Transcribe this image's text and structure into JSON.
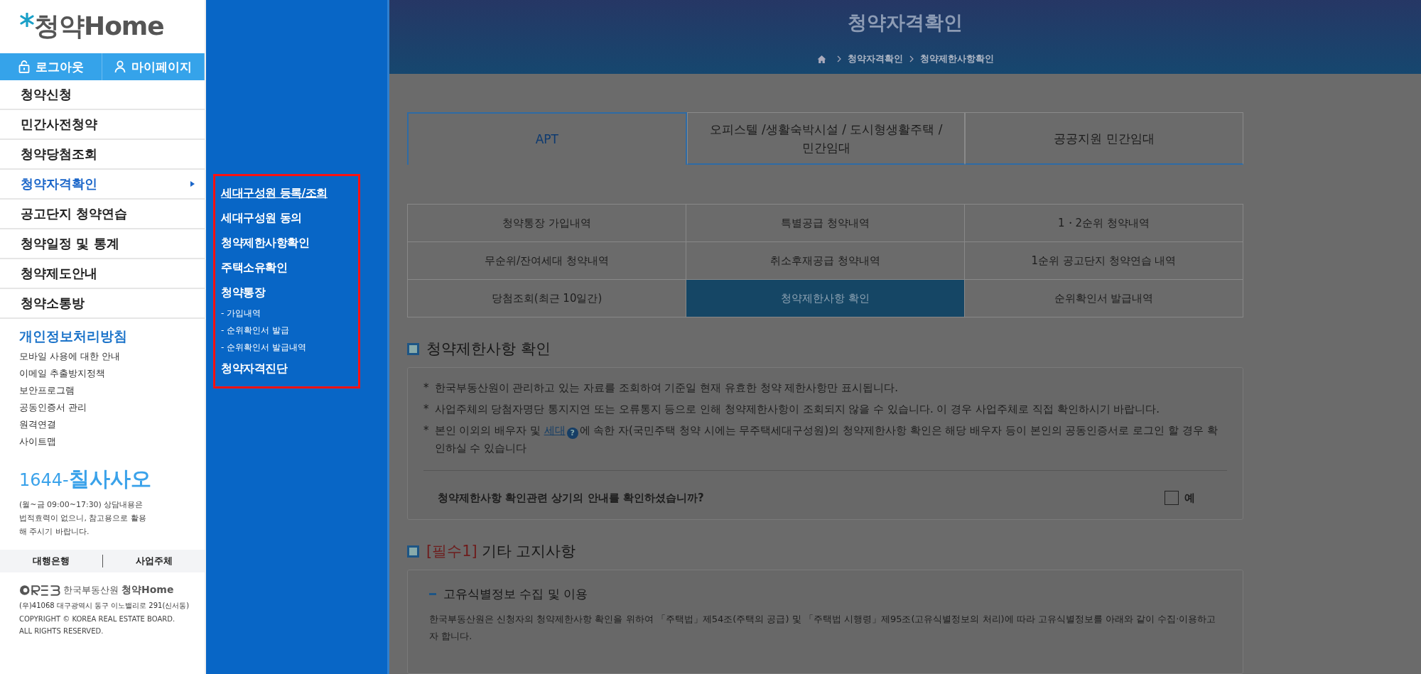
{
  "logo": {
    "text": "청약Home"
  },
  "account_buttons": [
    {
      "label": "로그아웃",
      "kind": "lock"
    },
    {
      "label": "마이페이지",
      "kind": "person"
    }
  ],
  "menu": [
    {
      "label": "청약신청",
      "selected": false
    },
    {
      "label": "민간사전청약",
      "selected": false
    },
    {
      "label": "청약당첨조회",
      "selected": false
    },
    {
      "label": "청약자격확인",
      "selected": true
    },
    {
      "label": "공고단지 청약연습",
      "selected": false
    },
    {
      "label": "청약일정 및 통계",
      "selected": false
    },
    {
      "label": "청약제도안내",
      "selected": false
    },
    {
      "label": "청약소통방",
      "selected": false
    }
  ],
  "policy_link": "개인정보처리방침",
  "footer_links": [
    "모바일 사용에 대한 안내",
    "이메일 추출방지정책",
    "보안프로그램",
    "공동인증서 관리",
    "원격연결",
    "사이트맵"
  ],
  "phone": {
    "digits": "1644-",
    "word": "칠사사오"
  },
  "hours_note": "(월~금 09:00~17:30) 상담내용은 법적효력이 없으니, 참고용으로 활용해 주시기 바랍니다.",
  "agents": [
    "대행은행",
    "사업주체"
  ],
  "org": {
    "name": "한국부동산원",
    "brand": "청약Home"
  },
  "address": "(우)41068 대구광역시 동구 이노밸리로 291(신서동)",
  "copyright": [
    "COPYRIGHT © KOREA REAL ESTATE BOARD.",
    "ALL RIGHTS RESERVED."
  ],
  "submenu": [
    {
      "label": "세대구성원 등록/조회",
      "kind": "main",
      "selected": true
    },
    {
      "label": "세대구성원 동의",
      "kind": "main",
      "selected": false
    },
    {
      "label": "청약제한사항확인",
      "kind": "main",
      "selected": false
    },
    {
      "label": "주택소유확인",
      "kind": "main",
      "selected": false
    },
    {
      "label": "청약통장",
      "kind": "main",
      "selected": false
    },
    {
      "label": "- 가입내역",
      "kind": "sub",
      "selected": false
    },
    {
      "label": "- 순위확인서 발급",
      "kind": "sub",
      "selected": false
    },
    {
      "label": "- 순위확인서 발급내역",
      "kind": "sub",
      "selected": false
    },
    {
      "label": "청약자격진단",
      "kind": "main",
      "selected": false
    }
  ],
  "header": {
    "title": "청약자격확인",
    "breadcrumb": [
      "청약자격확인",
      "청약제한사항확인"
    ]
  },
  "type_tabs": [
    {
      "label": "APT",
      "selected": true
    },
    {
      "label": "오피스텔 /생활숙박시설 / 도시형생활주택 / 민간임대",
      "selected": false
    },
    {
      "label": "공공지원 민간임대",
      "selected": false
    }
  ],
  "history_menu": [
    {
      "label": "청약통장 가입내역",
      "selected": false
    },
    {
      "label": "특별공급 청약내역",
      "selected": false
    },
    {
      "label": "1・2순위 청약내역",
      "selected": false
    },
    {
      "label": "무순위/잔여세대 청약내역",
      "selected": false
    },
    {
      "label": "취소후재공급 청약내역",
      "selected": false
    },
    {
      "label": "1순위 공고단지 청약연습 내역",
      "selected": false
    },
    {
      "label": "당첨조회(최근 10일간)",
      "selected": false
    },
    {
      "label": "청약제한사항 확인",
      "selected": true
    },
    {
      "label": "순위확인서 발급내역",
      "selected": false
    }
  ],
  "section1": {
    "title": "청약제한사항 확인",
    "notes": [
      {
        "mark": "*",
        "text": "한국부동산원이 관리하고 있는 자료를 조회하여 기준일 현재 유효한 청약 제한사항만 표시됩니다."
      },
      {
        "mark": "*",
        "text": "사업주체의 당첨자명단 통지지연 또는 오류통지 등으로 인해 청약제한사항이 조회되지 않을 수 있습니다. 이 경우 사업주체로 직접 확인하시기 바랍니다."
      },
      {
        "mark": "*",
        "text": "본인 이외의 배우자 및 ",
        "link": "세대",
        "help": "?",
        "after": "에 속한 자(국민주택 청약 시에는 무주택세대구성원)의 청약제한사항 확인은 해당 배우자 등이 본인의 공동인증서로 로그인 할 경우 확인하실 수 있습니다"
      }
    ],
    "question": "청약제한사항 확인관련 상기의 안내를 확인하셨습니까?",
    "checkbox": {
      "label": "예",
      "checked": false
    }
  },
  "section2": {
    "prefix": "[필수1]",
    "title": "기타 고지사항",
    "subheading": "고유식별정보 수집 및 이용",
    "paragraph": "한국부동산원은 신청자의 청약제한사항 확인을 위하여 「주택법」제54조(주택의 공급) 및 「주택법 시행령」제95조(고유식별정보의 처리)에 따라 고유식별정보를 아래와 같이 수집·이용하고자 합니다."
  }
}
